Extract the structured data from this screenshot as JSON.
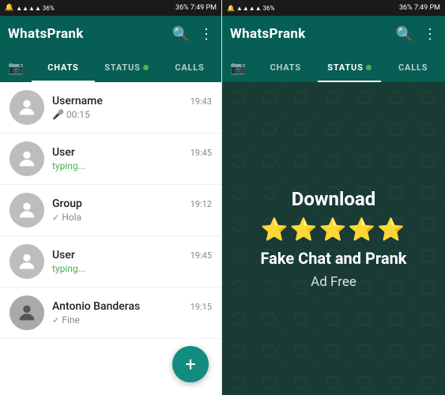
{
  "left": {
    "statusBar": {
      "left": "🔔 14 ⊙",
      "right": "36% 7:49 PM"
    },
    "appTitle": "WhatsPrank",
    "tabs": {
      "camera": "📷",
      "chats": "CHATS",
      "status": "STATUS",
      "calls": "CALLS",
      "activeTab": "chats"
    },
    "chats": [
      {
        "name": "Username",
        "time": "19:43",
        "preview": "00:15",
        "previewType": "mic",
        "hasAvatar": false
      },
      {
        "name": "User",
        "time": "19:45",
        "preview": "typing...",
        "previewType": "typing",
        "hasAvatar": false
      },
      {
        "name": "Group",
        "time": "19:12",
        "preview": "Hola",
        "previewType": "check",
        "hasAvatar": false
      },
      {
        "name": "User",
        "time": "19:45",
        "preview": "typing...",
        "previewType": "typing",
        "hasAvatar": false
      },
      {
        "name": "Antonio Banderas",
        "time": "19:15",
        "preview": "Fine",
        "previewType": "check",
        "hasAvatar": true
      }
    ],
    "fab": "+"
  },
  "right": {
    "statusBar": {
      "left": "🔔 14 ⊙",
      "right": "36% 7:49 PM"
    },
    "appTitle": "WhatsPrank",
    "tabs": {
      "camera": "📷",
      "chats": "CHATS",
      "status": "STATUS",
      "calls": "CALLS",
      "activeTab": "status"
    },
    "promo": {
      "download": "Download",
      "stars": "⭐⭐⭐⭐⭐",
      "title": "Fake Chat and Prank",
      "subtitle": "Ad Free"
    }
  }
}
